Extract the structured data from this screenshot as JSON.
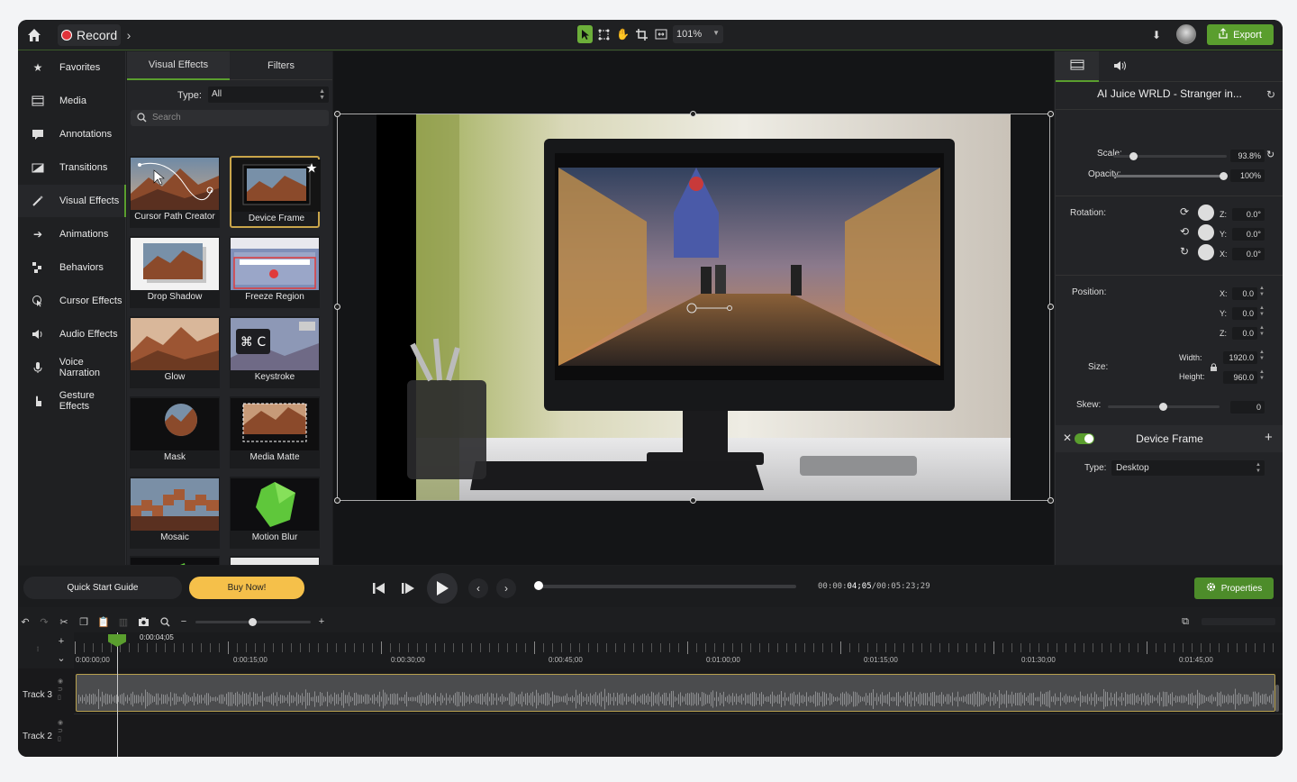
{
  "topbar": {
    "record_label": "Record",
    "zoom": "101%",
    "export_label": "Export"
  },
  "leftnav": {
    "items": [
      {
        "label": "Favorites",
        "icon": "star-icon"
      },
      {
        "label": "Media",
        "icon": "film-icon"
      },
      {
        "label": "Annotations",
        "icon": "annotation-icon"
      },
      {
        "label": "Transitions",
        "icon": "transition-icon"
      },
      {
        "label": "Visual Effects",
        "icon": "wand-icon"
      },
      {
        "label": "Animations",
        "icon": "arrow-icon"
      },
      {
        "label": "Behaviors",
        "icon": "behaviors-icon"
      },
      {
        "label": "Cursor Effects",
        "icon": "cursor-icon"
      },
      {
        "label": "Audio Effects",
        "icon": "speaker-icon"
      },
      {
        "label": "Voice Narration",
        "icon": "mic-icon"
      },
      {
        "label": "Gesture Effects",
        "icon": "hand-icon"
      }
    ]
  },
  "fxpanel": {
    "tabs": [
      "Visual Effects",
      "Filters"
    ],
    "type_label": "Type:",
    "type_value": "All",
    "search_placeholder": "Search",
    "tiles": [
      "Cursor Path Creator",
      "Device Frame",
      "Drop Shadow",
      "Freeze Region",
      "Glow",
      "Keystroke",
      "Mask",
      "Media Matte",
      "Mosaic",
      "Motion Blur"
    ],
    "keystroke_text": "⌘ C"
  },
  "properties": {
    "media_title": "AI Juice WRLD - Stranger in...",
    "scale_label": "Scale:",
    "scale": "93.8%",
    "opacity_label": "Opacity:",
    "opacity": "100%",
    "rotation_label": "Rotation:",
    "rot_z_label": "Z:",
    "rot_z": "0.0°",
    "rot_y_label": "Y:",
    "rot_y": "0.0°",
    "rot_x_label": "X:",
    "rot_x": "0.0°",
    "position_label": "Position:",
    "pos_x_label": "X:",
    "pos_x": "0.0",
    "pos_y_label": "Y:",
    "pos_y": "0.0",
    "pos_z_label": "Z:",
    "pos_z": "0.0",
    "size_label": "Size:",
    "width_label": "Width:",
    "width": "1920.0",
    "height_label": "Height:",
    "height": "960.0",
    "skew_label": "Skew:",
    "skew": "0",
    "effect_name": "Device Frame",
    "effect_type_label": "Type:",
    "effect_type": "Desktop"
  },
  "controls": {
    "quick_start": "Quick Start Guide",
    "buy_now": "Buy Now!",
    "time_prefix": "00:00:",
    "time_current": "04;05",
    "time_total": "/00:05:23;29",
    "properties_label": "Properties"
  },
  "timeline": {
    "playhead_time": "0:00:04;05",
    "ticks": [
      "0:00:00;00",
      "0:00:15;00",
      "0:00:30;00",
      "0:00:45;00",
      "0:01:00;00",
      "0:01:15;00",
      "0:01:30;00",
      "0:01:45;00"
    ],
    "tracks": [
      "Track 3",
      "Track 2"
    ]
  }
}
